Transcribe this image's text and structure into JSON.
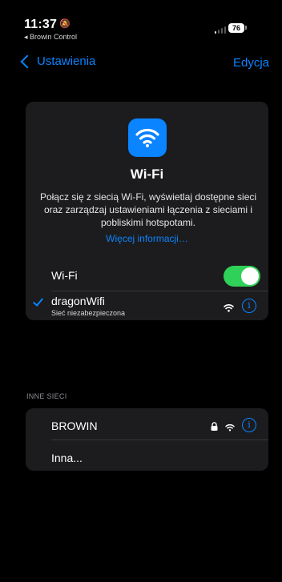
{
  "status_bar": {
    "time": "11:37",
    "back_app": "◂ Browin Control",
    "battery": "76"
  },
  "nav": {
    "back_label": "Ustawienia",
    "edit_label": "Edycja"
  },
  "wifi_card": {
    "title": "Wi-Fi",
    "description": "Połącz się z siecią Wi-Fi, wyświetlaj dostępne sieci oraz zarządzaj ustawieniami łączenia z sieciami i pobliskimi hotspotami.",
    "more_link": "Więcej informacji…",
    "toggle_label": "Wi-Fi",
    "toggle_on": true,
    "connected_network": {
      "name": "dragonWifi",
      "subtitle": "Sieć niezabezpieczona"
    }
  },
  "other_networks": {
    "section_title": "INNE SIECI",
    "networks": [
      {
        "name": "BROWIN",
        "locked": true
      }
    ],
    "other_label": "Inna..."
  },
  "colors": {
    "accent": "#0a84ff",
    "toggle_on": "#30d158",
    "card_bg": "#1c1c1e",
    "background": "#000000"
  }
}
